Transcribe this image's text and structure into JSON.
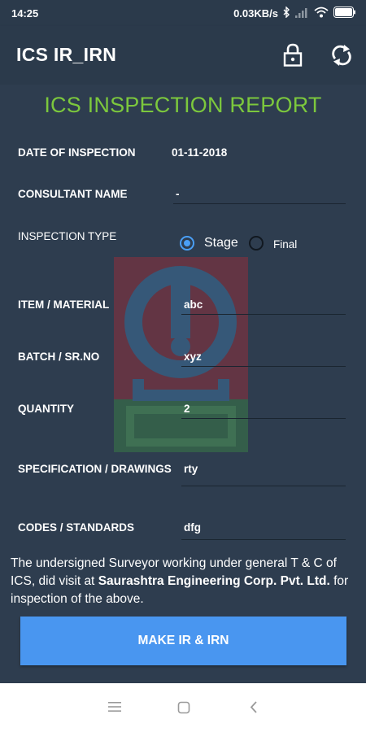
{
  "status_bar": {
    "time": "14:25",
    "network_speed": "0.03KB/s",
    "battery_level": 1.0,
    "icons": [
      "bluetooth-icon",
      "signal-icon",
      "wifi-icon",
      "battery-icon"
    ]
  },
  "app_bar": {
    "title": "ICS IR_IRN",
    "actions": [
      "lock-icon",
      "sync-icon"
    ]
  },
  "report": {
    "title": "ICS INSPECTION REPORT",
    "date_label": "DATE OF INSPECTION",
    "date_value": "01-11-2018",
    "consultant_label": "CONSULTANT NAME",
    "consultant_value": "-",
    "inspection_type_label": "INSPECTION TYPE",
    "inspection_type_options": [
      "Stage",
      "Final"
    ],
    "inspection_type_selected": "Stage",
    "item_label": "ITEM / MATERIAL",
    "item_value": "abc",
    "batch_label": "BATCH / SR.NO",
    "batch_value": "xyz",
    "quantity_label": "QUANTITY",
    "quantity_value": "2",
    "spec_label": "SPECIFICATION / DRAWINGS",
    "spec_value": "rty",
    "codes_label": "CODES / STANDARDS",
    "codes_value": "dfg"
  },
  "note": {
    "text_1": "The undersigned Surveyor working under general T & C of ICS, did visit at ",
    "company": "Saurashtra Engineering Corp. Pvt. Ltd.",
    "text_2": " for inspection of the above."
  },
  "submit_button": {
    "label": "MAKE IR & IRN"
  },
  "nav_bar": {
    "icons": [
      "menu-icon",
      "home-square-icon",
      "back-icon"
    ]
  },
  "colors": {
    "background": "#2e3d4f",
    "app_bar": "#2b3a4b",
    "title_green": "#7cc83d",
    "accent_blue": "#4996f0",
    "radio_blue": "#4a9ff5"
  }
}
